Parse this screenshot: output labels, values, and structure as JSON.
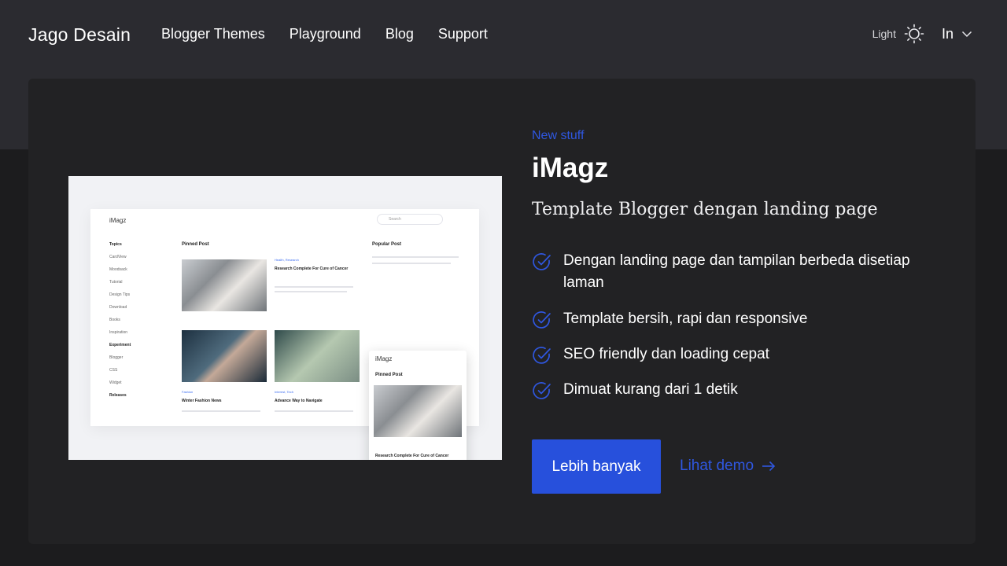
{
  "header": {
    "logo": "Jago Desain",
    "nav": [
      "Blogger Themes",
      "Playground",
      "Blog",
      "Support"
    ],
    "theme_label": "Light",
    "language": "In"
  },
  "hero": {
    "eyebrow": "New stuff",
    "title": "iMagz",
    "subtitle": "Template Blogger dengan landing page",
    "features": [
      "Dengan landing page dan tampilan berbeda disetiap laman",
      "Template bersih, rapi dan responsive",
      "SEO friendly dan loading cepat",
      "Dimuat kurang dari 1 detik"
    ],
    "primary_button": "Lebih banyak",
    "secondary_link": "Lihat demo"
  },
  "preview": {
    "logo": "iMagz",
    "search_placeholder": "Search",
    "sidebar": [
      "Topics",
      "CardView",
      "Moodsack",
      "Tutorial",
      "Design Tips",
      "Download",
      "Books",
      "Inspiration",
      "Experiment",
      "Blogger",
      "CSS",
      "Widget",
      "Releases"
    ],
    "pinned_label": "Pinned Post",
    "popular_label": "Popular Post",
    "posts": [
      {
        "category": "Health, Research",
        "title": "Research Complete For Cure of Cancer"
      },
      {
        "category": "Fashion",
        "title": "Winter Fashion News"
      },
      {
        "category": "Interest, Tech",
        "title": "Advance Way to Navigate"
      }
    ],
    "mobile_post": "Research Complete For Cure of Cancer"
  },
  "colors": {
    "accent": "#2750dc",
    "link": "#2f57e0",
    "background": "#1c1c1e",
    "card": "#222224"
  }
}
